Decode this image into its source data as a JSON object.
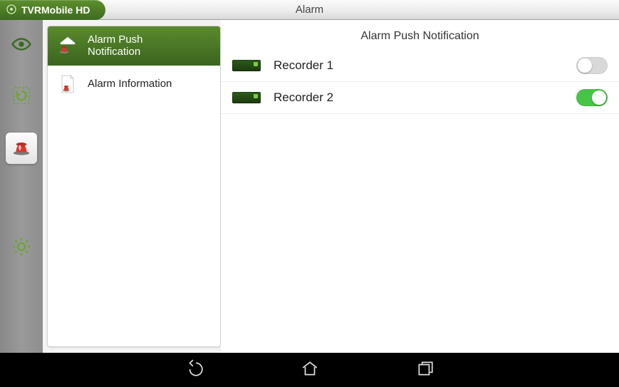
{
  "app": {
    "brand": "TVRMobile HD",
    "screen_title": "Alarm"
  },
  "rail": {
    "items": [
      {
        "name": "live-view",
        "active": false
      },
      {
        "name": "playback",
        "active": false
      },
      {
        "name": "alarm",
        "active": true
      },
      {
        "name": "settings",
        "active": false
      }
    ]
  },
  "sidebar": {
    "items": [
      {
        "label": "Alarm Push Notification",
        "selected": true
      },
      {
        "label": "Alarm Information",
        "selected": false
      }
    ]
  },
  "content": {
    "header": "Alarm Push Notification",
    "recorders": [
      {
        "label": "Recorder 1",
        "enabled": false
      },
      {
        "label": "Recorder 2",
        "enabled": true
      }
    ]
  },
  "navbar": {
    "buttons": [
      "back",
      "home",
      "recent"
    ]
  }
}
